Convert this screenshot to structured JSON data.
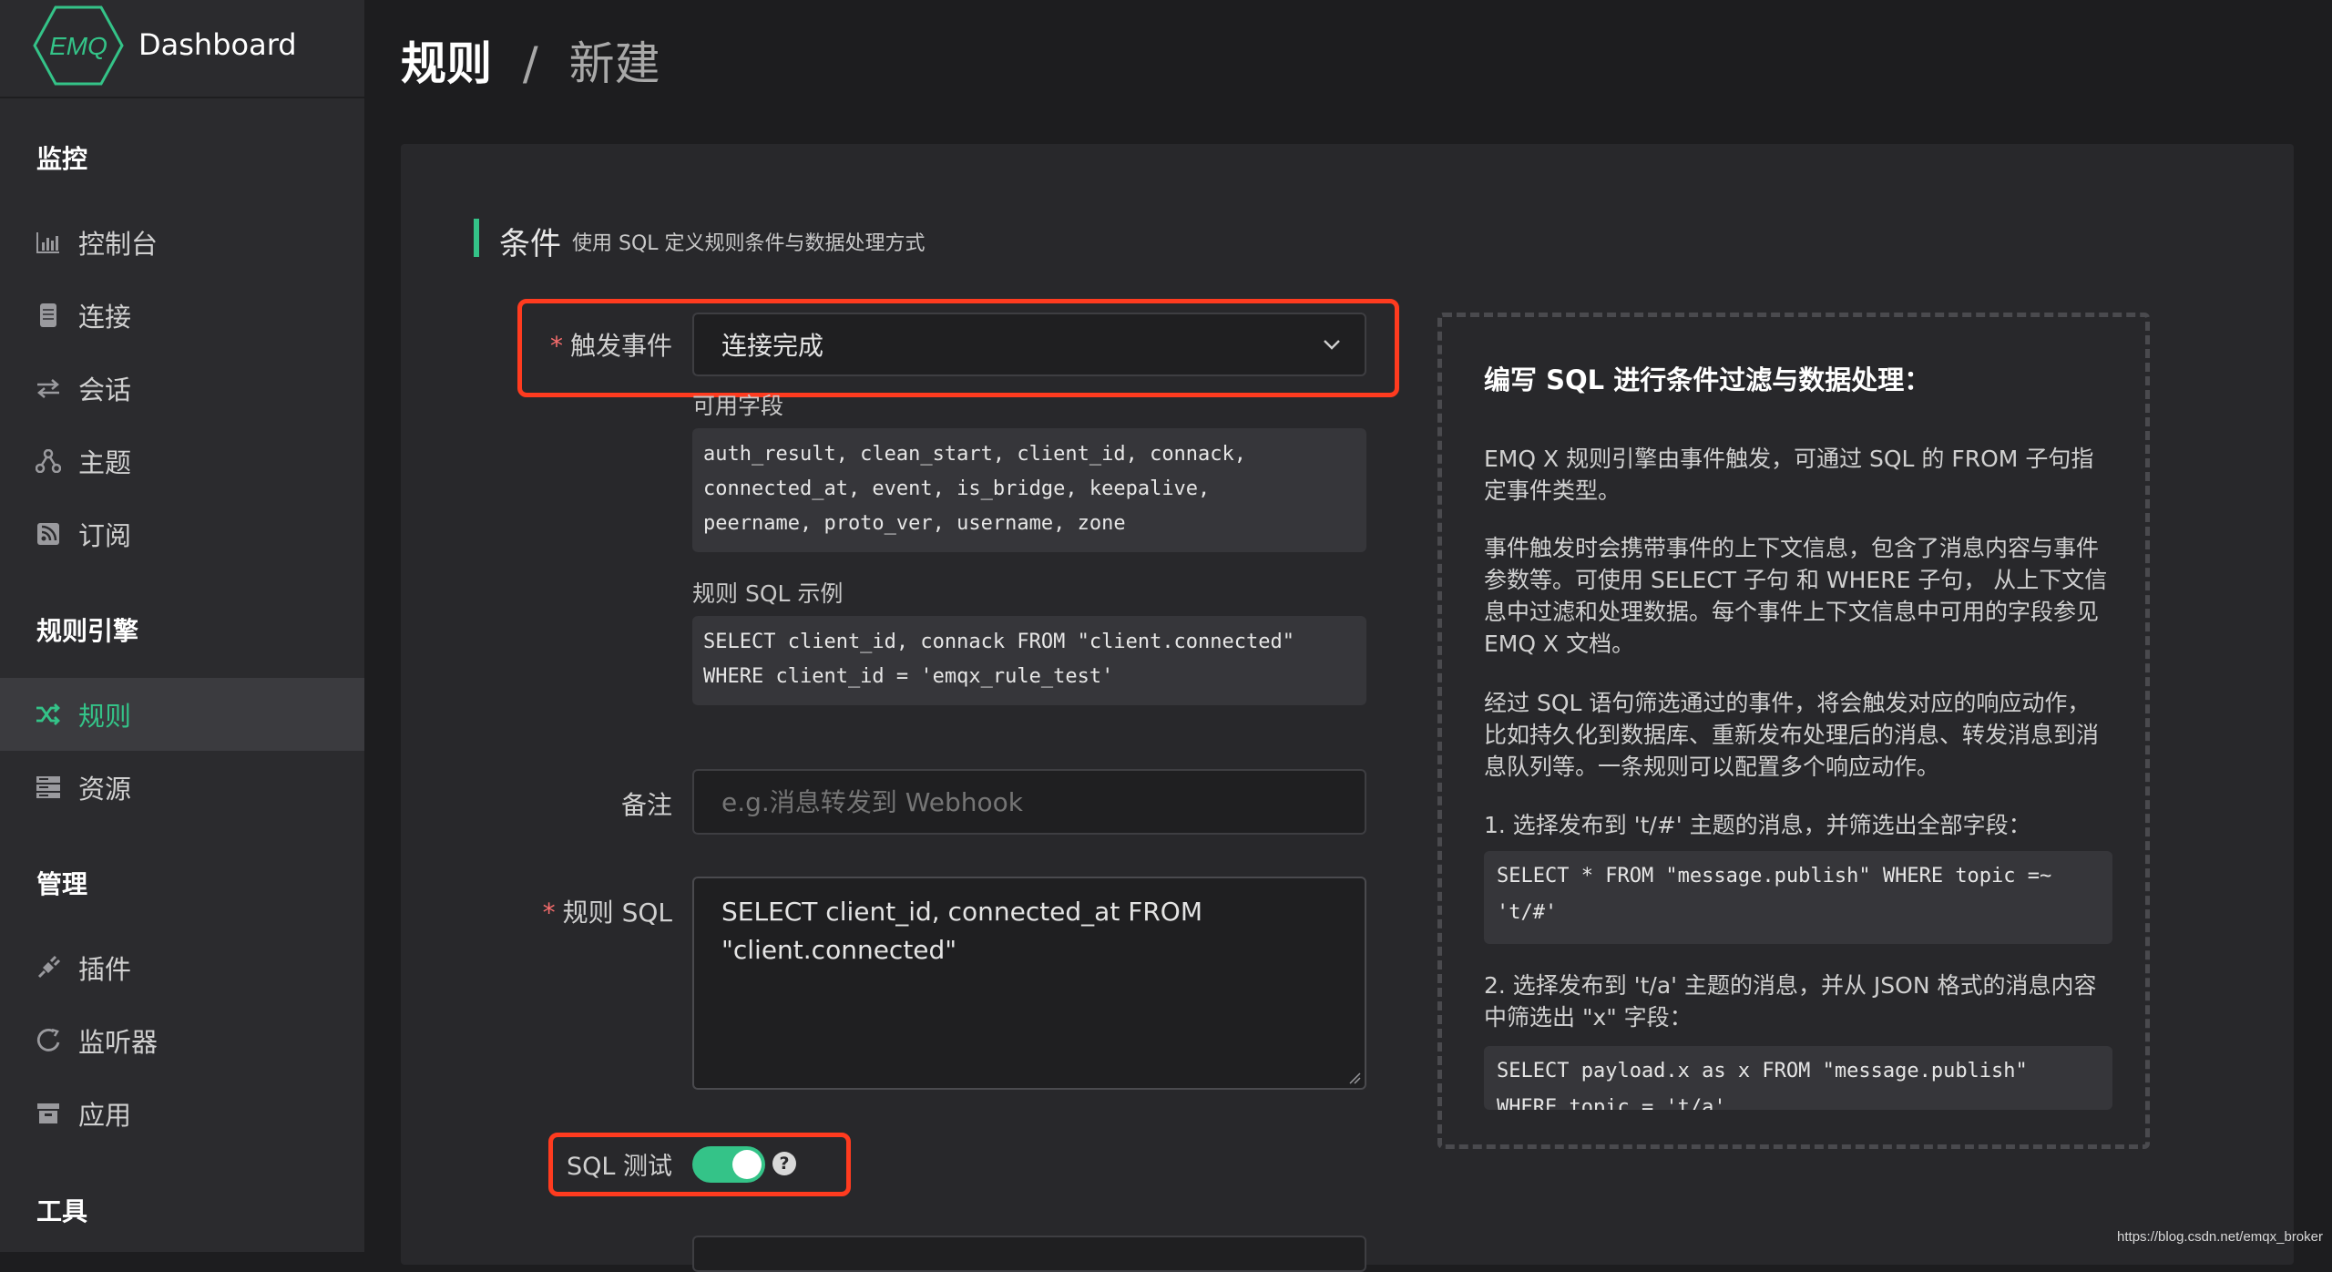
{
  "brand": {
    "logo_text": "EMQ",
    "title": "Dashboard"
  },
  "sidebar": {
    "sections": [
      {
        "label": "监控"
      },
      {
        "label": "规则引擎"
      },
      {
        "label": "管理"
      },
      {
        "label": "工具"
      }
    ],
    "items": [
      {
        "label": "控制台",
        "icon": "bar-chart-icon"
      },
      {
        "label": "连接",
        "icon": "device-icon"
      },
      {
        "label": "会话",
        "icon": "swap-arrows-icon"
      },
      {
        "label": "主题",
        "icon": "topic-tree-icon"
      },
      {
        "label": "订阅",
        "icon": "rss-icon"
      },
      {
        "label": "规则",
        "icon": "shuffle-icon",
        "active": true
      },
      {
        "label": "资源",
        "icon": "server-icon"
      },
      {
        "label": "插件",
        "icon": "plug-icon"
      },
      {
        "label": "监听器",
        "icon": "listener-icon"
      },
      {
        "label": "应用",
        "icon": "archive-icon"
      }
    ],
    "active_color": "#34c388"
  },
  "header": {
    "crumb1": "规则",
    "separator": "/",
    "crumb2": "新建"
  },
  "section": {
    "title": "条件",
    "desc": "使用 SQL 定义规则条件与数据处理方式"
  },
  "form": {
    "event_label": "触发事件",
    "event_value": "连接完成",
    "fields_label": "可用字段",
    "fields_code": "auth_result, clean_start, client_id, connack,\nconnected_at, event, is_bridge, keepalive,\npeername, proto_ver, username, zone",
    "example_label": "规则 SQL 示例",
    "example_code": "SELECT client_id, connack FROM \"client.connected\"\nWHERE client_id = 'emqx_rule_test'",
    "remark_label": "备注",
    "remark_placeholder": "e.g.消息转发到 Webhook",
    "sql_label": "规则 SQL",
    "sql_value": "SELECT client_id, connected_at FROM\n\"client.connected\"",
    "sql_test_label": "SQL 测试",
    "sql_test_enabled": true,
    "required_mark": "*",
    "help_mark": "?"
  },
  "help": {
    "title": "编写 SQL 进行条件过滤与数据处理：",
    "p1": "EMQ X 规则引擎由事件触发，可通过 SQL 的 FROM 子句指定事件类型。",
    "p2": "事件触发时会携带事件的上下文信息，包含了消息内容与事件参数等。可使用 SELECT 子句 和 WHERE 子句， 从上下文信息中过滤和处理数据。每个事件上下文信息中可用的字段参见 EMQ X 文档。",
    "p3": "经过 SQL 语句筛选通过的事件，将会触发对应的响应动作，比如持久化到数据库、重新发布处理后的消息、转发消息到消息队列等。一条规则可以配置多个响应动作。",
    "example1_label": "1. 选择发布到 't/#' 主题的消息，并筛选出全部字段：",
    "example1_code": "SELECT * FROM \"message.publish\" WHERE topic =~\n't/#'",
    "example2_label": "2. 选择发布到 't/a' 主题的消息，并从 JSON 格式的消息内容中筛选出 \"x\" 字段：",
    "example2_code": "SELECT payload.x as x FROM \"message.publish\"\nWHERE topic = 't/a'"
  },
  "watermark": "https://blog.csdn.net/emqx_broker",
  "colors": {
    "accent": "#34c388",
    "highlight": "#ff3b1f",
    "required": "#f56c6c"
  }
}
